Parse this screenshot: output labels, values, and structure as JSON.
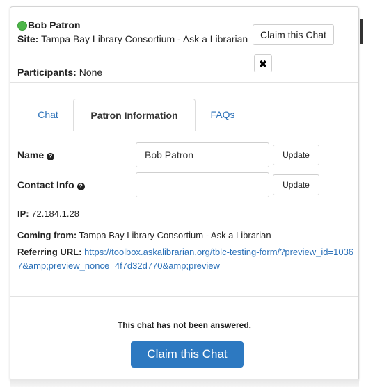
{
  "header": {
    "patron_name": "Bob Patron",
    "site_label": "Site:",
    "site_value": "Tampa Bay Library Consortium - Ask a Librarian",
    "participants_label": "Participants:",
    "participants_value": "None",
    "claim_button": "Claim this Chat",
    "close_glyph": "✖",
    "status_color": "#4cb648"
  },
  "tabs": [
    {
      "label": "Chat",
      "active": false
    },
    {
      "label": "Patron Information",
      "active": true
    },
    {
      "label": "FAQs",
      "active": false
    }
  ],
  "form": {
    "name_label": "Name",
    "name_value": "Bob Patron",
    "contact_label": "Contact Info",
    "contact_value": "",
    "update_label": "Update",
    "help_glyph": "?"
  },
  "details": {
    "ip_label": "IP:",
    "ip_value": "72.184.1.28",
    "coming_label": "Coming from:",
    "coming_value": "Tampa Bay Library Consortium - Ask a Librarian",
    "referring_label": "Referring URL:",
    "referring_url": "https://toolbox.askalibrarian.org/tblc-testing-form/?preview_id=10367&amp;preview_nonce=4f7d32d770&amp;preview"
  },
  "footer": {
    "notice": "This chat has not been answered.",
    "claim_button": "Claim this Chat"
  },
  "colors": {
    "link": "#2a70b8",
    "primary_button": "#2d79c1"
  }
}
